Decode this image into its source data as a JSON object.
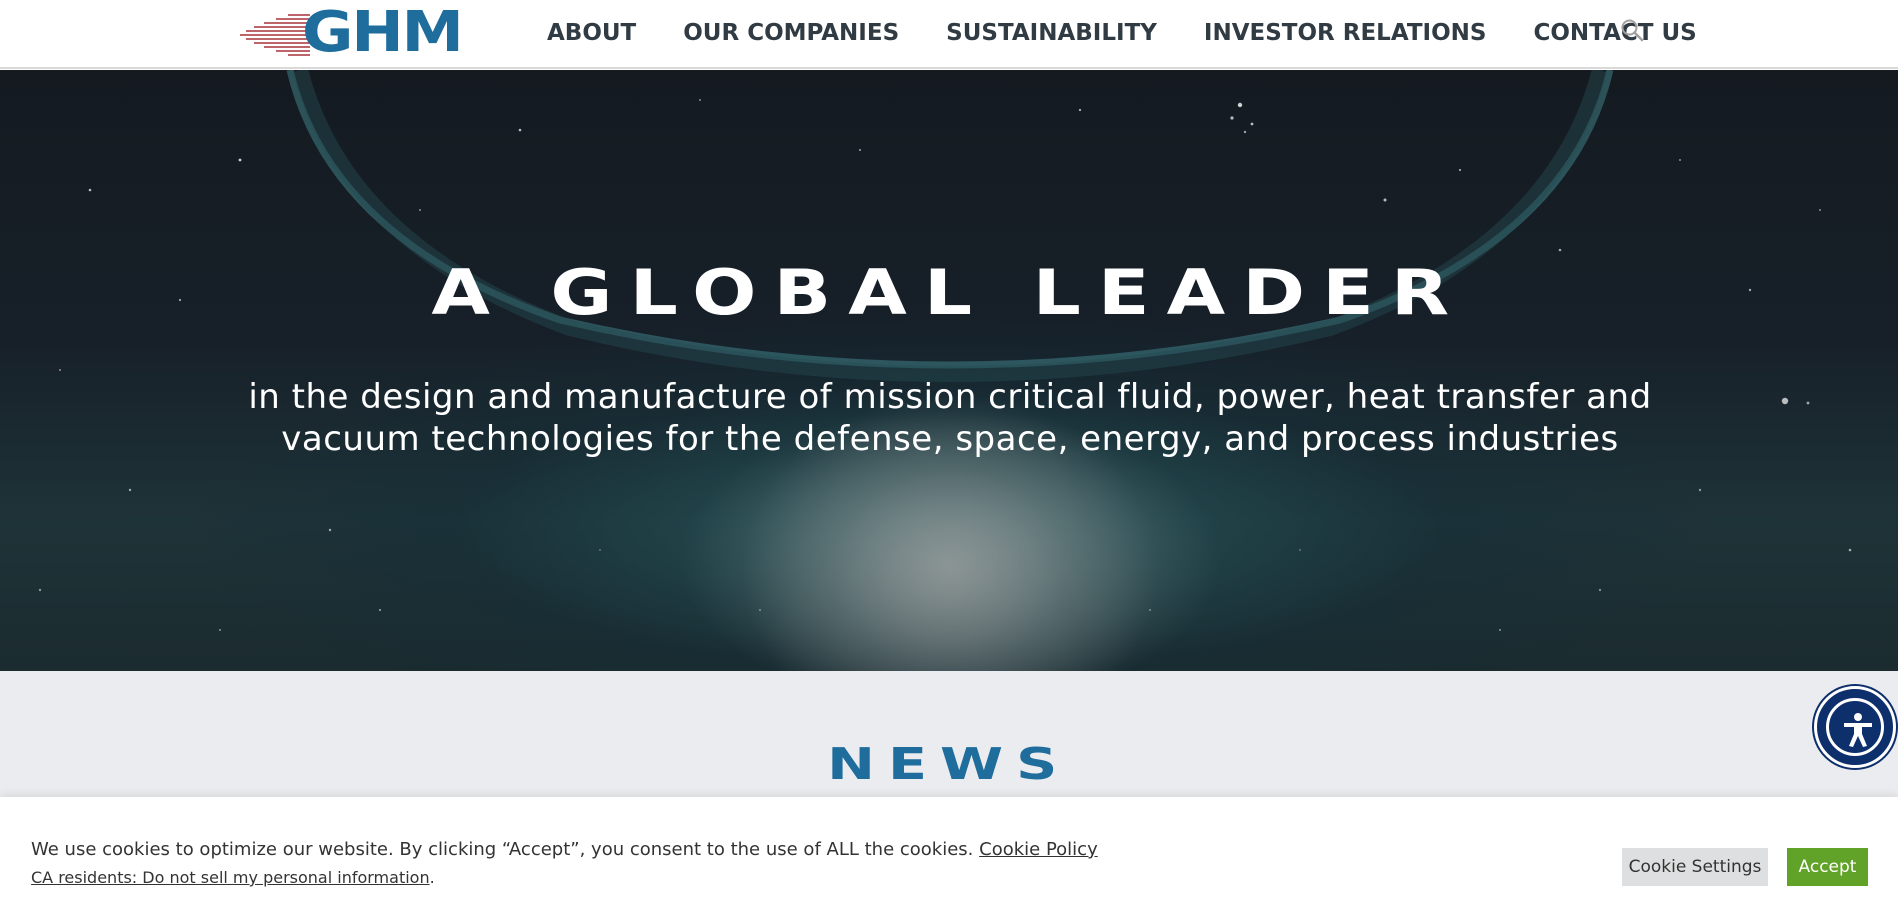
{
  "header": {
    "logo_text": "GHM",
    "nav": [
      "ABOUT",
      "OUR COMPANIES",
      "SUSTAINABILITY",
      "INVESTOR RELATIONS",
      "CONTACT US"
    ],
    "search_icon": "search-icon"
  },
  "hero": {
    "title": "A GLOBAL LEADER",
    "subtitle_line1": "in the design and manufacture of mission critical fluid, power, heat transfer and",
    "subtitle_line2": "vacuum technologies for the defense, space, energy, and process industries"
  },
  "news": {
    "title": "NEWS"
  },
  "accessibility": {
    "icon": "accessibility-icon"
  },
  "cookie": {
    "text": "We use cookies to optimize our website. By clicking “Accept”, you consent to the use of ALL the cookies.",
    "policy_link": "Cookie Policy",
    "ca_link": "CA residents: Do not sell my personal information",
    "ca_suffix": ".",
    "settings_label": "Cookie Settings",
    "accept_label": "Accept"
  },
  "colors": {
    "brand_blue": "#1f6d9c",
    "nav_text": "#303b44",
    "accept_green": "#61a229",
    "accessibility_navy": "#0d2f6b",
    "logo_stripes": "#a8323c"
  }
}
